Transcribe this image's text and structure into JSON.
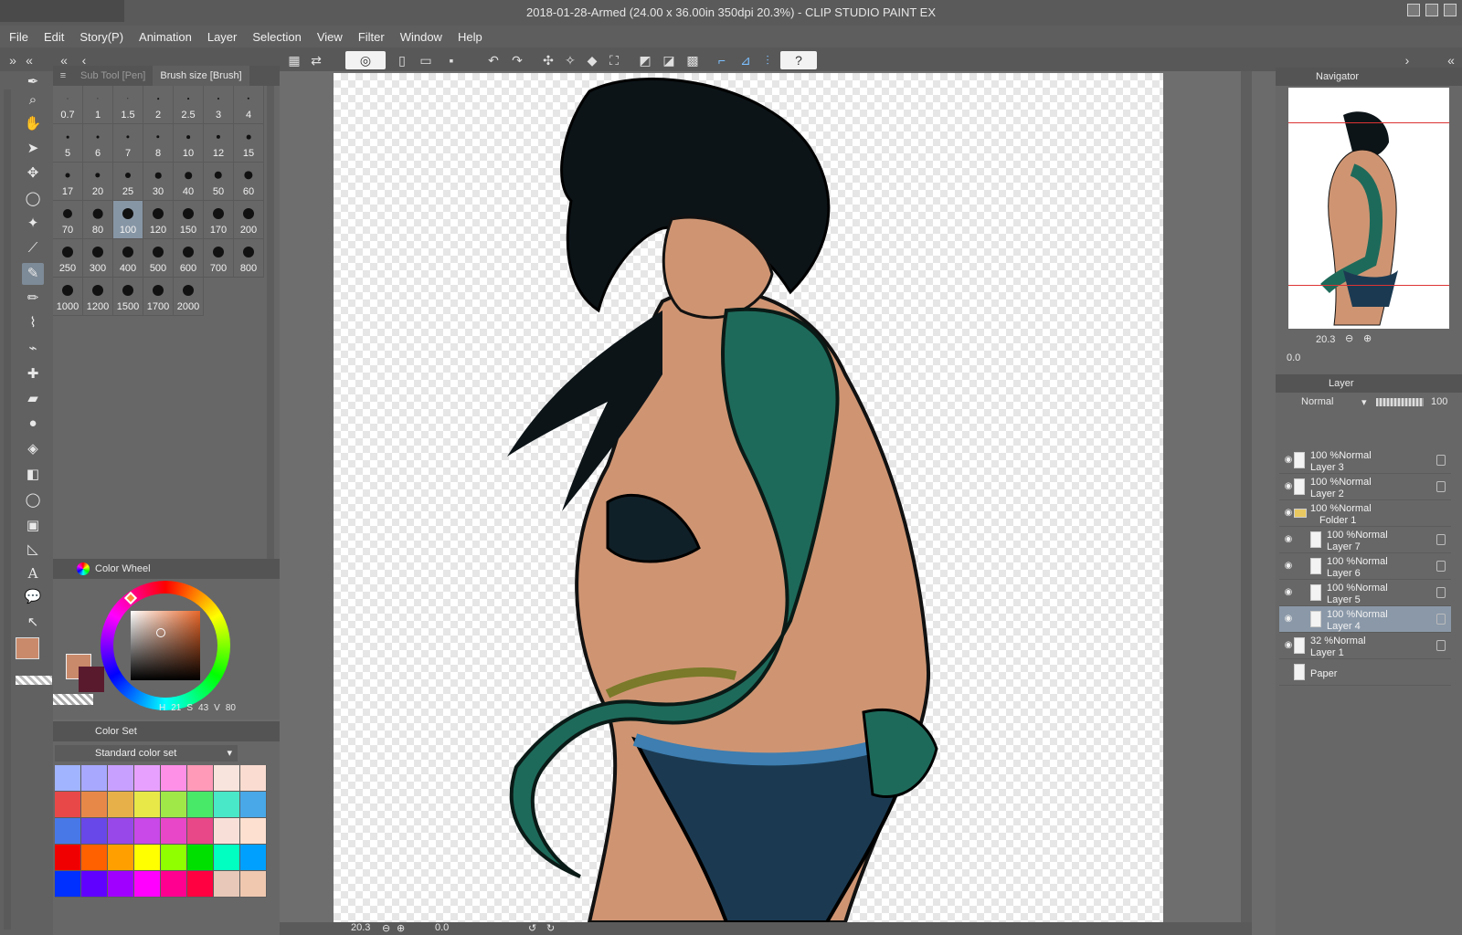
{
  "window": {
    "title": "2018-01-28-Armed (24.00 x 36.00in 350dpi 20.3%) - CLIP STUDIO PAINT EX"
  },
  "menu": [
    "File",
    "Edit",
    "Story(P)",
    "Animation",
    "Layer",
    "Selection",
    "View",
    "Filter",
    "Window",
    "Help"
  ],
  "subtool_panel": {
    "tabs": [
      "Sub Tool [Pen]",
      "Brush size [Brush]"
    ],
    "brush_sizes": [
      "0.7",
      "1",
      "1.5",
      "2",
      "2.5",
      "3",
      "4",
      "5",
      "6",
      "7",
      "8",
      "10",
      "12",
      "15",
      "17",
      "20",
      "25",
      "30",
      "40",
      "50",
      "60",
      "70",
      "80",
      "100",
      "120",
      "150",
      "170",
      "200",
      "250",
      "300",
      "400",
      "500",
      "600",
      "700",
      "800",
      "1000",
      "1200",
      "1500",
      "1700",
      "2000"
    ],
    "selected": "100"
  },
  "color_wheel": {
    "title": "Color Wheel",
    "h_label": "H",
    "h": "21",
    "s_label": "S",
    "s": "43",
    "v_label": "V",
    "v": "80",
    "main_color": "#c98a6b",
    "sub_color": "#5a1a2e"
  },
  "color_set": {
    "title": "Color Set",
    "selected_set": "Standard color set",
    "colors": [
      "#a0b4ff",
      "#a8a8ff",
      "#c8a0ff",
      "#e8a0ff",
      "#ff90e8",
      "#ff9ab8",
      "#f8e4dc",
      "#fadcd0",
      "#e84848",
      "#e88848",
      "#e8b048",
      "#e8e848",
      "#a0e848",
      "#48e868",
      "#48e8c8",
      "#48a8e8",
      "#4878e8",
      "#6848e8",
      "#9848e8",
      "#c848e8",
      "#e848c8",
      "#e84888",
      "#f8e0d8",
      "#fde0d0",
      "#f00000",
      "#ff6000",
      "#ffa000",
      "#ffff00",
      "#90ff00",
      "#00e000",
      "#00ffc0",
      "#00a0ff",
      "#0030ff",
      "#6000ff",
      "#a000ff",
      "#ff00ff",
      "#ff0090",
      "#ff0040",
      "#e8c8b8",
      "#f0c8b0"
    ]
  },
  "navigator": {
    "title": "Navigator",
    "zoom": "20.3",
    "rotation": "0.0"
  },
  "layer_panel": {
    "title": "Layer",
    "blend_mode": "Normal",
    "opacity": "100",
    "layers": [
      {
        "mode": "100 %Normal",
        "name": "Layer 3",
        "indent": 0,
        "selected": false
      },
      {
        "mode": "100 %Normal",
        "name": "Layer 2",
        "indent": 0,
        "selected": false
      },
      {
        "mode": "100 %Normal",
        "name": "Folder 1",
        "indent": 0,
        "selected": false,
        "folder": true
      },
      {
        "mode": "100 %Normal",
        "name": "Layer 7",
        "indent": 1,
        "selected": false
      },
      {
        "mode": "100 %Normal",
        "name": "Layer 6",
        "indent": 1,
        "selected": false
      },
      {
        "mode": "100 %Normal",
        "name": "Layer 5",
        "indent": 1,
        "selected": false
      },
      {
        "mode": "100 %Normal",
        "name": "Layer 4",
        "indent": 1,
        "selected": true
      },
      {
        "mode": "32 %Normal",
        "name": "Layer 1",
        "indent": 0,
        "selected": false
      },
      {
        "mode": "",
        "name": "Paper",
        "indent": 0,
        "selected": false
      }
    ]
  },
  "status": {
    "zoom": "20.3",
    "rotation": "0.0"
  }
}
